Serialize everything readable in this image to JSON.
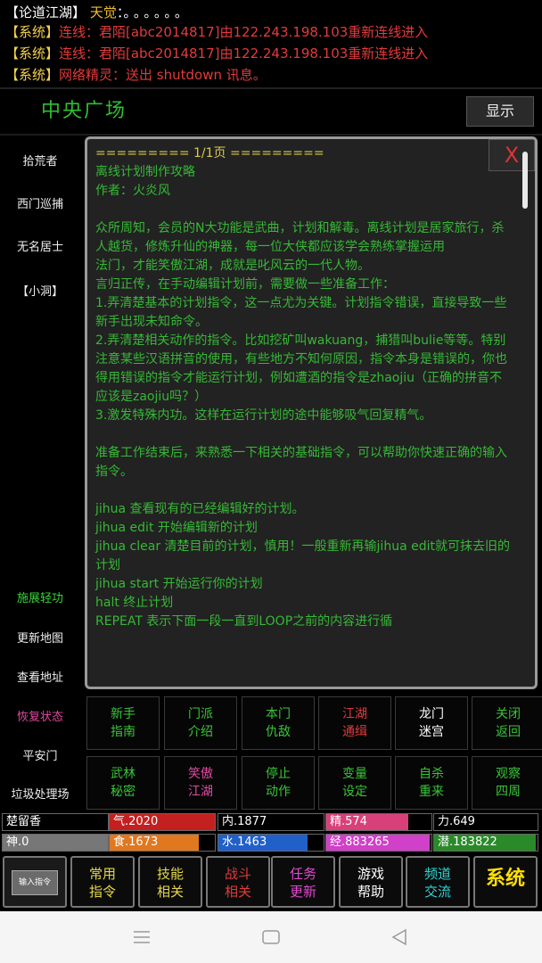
{
  "chat": {
    "title": {
      "bracket_open": "【",
      "channel": "论道江湖",
      "bracket_close": "】",
      "name": "天觉",
      "sep": "：",
      "dots": "。。。。。。"
    },
    "lines": [
      {
        "tag": "【系统】",
        "text": "连线：君陌[abc2014817]由122.243.198.103重新连线进入"
      },
      {
        "tag": "【系统】",
        "text": "连线：君陌[abc2014817]由122.243.198.103重新连线进入"
      },
      {
        "tag": "【系统】",
        "text": "网络精灵：送出 shutdown 讯息。"
      }
    ]
  },
  "header": {
    "room": "中央广场",
    "show_button": "显示"
  },
  "sidebar": {
    "top": [
      "拾荒者",
      "西门巡捕",
      "无名居士",
      "【小洞】"
    ],
    "bottom": [
      {
        "label": "施展轻功",
        "color": "green"
      },
      {
        "label": "更新地图",
        "color": "white"
      },
      {
        "label": "查看地址",
        "color": "white"
      },
      {
        "label": "恢复状态",
        "color": "pink"
      },
      {
        "label": "平安门",
        "color": "white"
      },
      {
        "label": "垃圾处理场",
        "color": "white"
      }
    ]
  },
  "dialog": {
    "page_header": "========= 1/1页 =========",
    "close": "X",
    "body": "离线计划制作攻略\n作者：火炎风\n\n众所周知，会员的N大功能是武曲，计划和解毒。离线计划是居家旅行，杀人越货，修炼升仙的神器，每一位大侠都应该学会熟练掌握运用\n法门，才能笑傲江湖，成就是叱风云的一代人物。\n言归正传，在手动编辑计划前，需要做一些准备工作：\n1.弄清楚基本的计划指令，这一点尤为关键。计划指令错误，直接导致一些新手出现未知命令。\n2.弄清楚相关动作的指令。比如挖矿叫wakuang，捕猎叫bulie等等。特别注意某些汉语拼音的使用，有些地方不知何原因，指令本身是错误的，你也得用错误的指令才能运行计划，例如遭酒的指令是zhaojiu（正确的拼音不应该是zaojiu吗？）\n3.激发特殊内功。这样在运行计划的途中能够吸气回复精气。\n\n准备工作结束后，来熟悉一下相关的基础指令，可以帮助你快速正确的输入指令。\n\njihua 查看现有的已经编辑好的计划。\njihua edit 开始编辑新的计划\njihua clear 清楚目前的计划，慎用！一般重新再输jihua edit就可抹去旧的计划\njihua start 开始运行你的计划\nhalt 终止计划\nREPEAT 表示下面一段一直到LOOP之前的内容进行循"
  },
  "actions": [
    {
      "l1": "新手",
      "l2": "指南",
      "color": "#39c439"
    },
    {
      "l1": "门派",
      "l2": "介绍",
      "color": "#39c439"
    },
    {
      "l1": "本门",
      "l2": "仇敌",
      "color": "#39c439"
    },
    {
      "l1": "江湖",
      "l2": "通缉",
      "color": "#e23b3b"
    },
    {
      "l1": "龙门",
      "l2": "迷宫",
      "color": "#ffffff"
    },
    {
      "l1": "关闭",
      "l2": "返回",
      "color": "#39c439"
    },
    {
      "l1": "武林",
      "l2": "秘密",
      "color": "#39c439"
    },
    {
      "l1": "笑傲",
      "l2": "江湖",
      "color": "#e04aa0"
    },
    {
      "l1": "停止",
      "l2": "动作",
      "color": "#39c439"
    },
    {
      "l1": "变量",
      "l2": "设定",
      "color": "#39c439"
    },
    {
      "l1": "自杀",
      "l2": "重来",
      "color": "#39c439"
    },
    {
      "l1": "观察",
      "l2": "四周",
      "color": "#39c439"
    }
  ],
  "stats": {
    "row1": [
      {
        "label": "楚留香",
        "fill": 0.0,
        "color": "#000000"
      },
      {
        "label": "气.2020",
        "fill": 1.0,
        "color": "#c42020"
      },
      {
        "label": "内.1877",
        "fill": 0.0,
        "color": "#000000"
      },
      {
        "label": "精.574",
        "fill": 0.78,
        "color": "#d8407a"
      },
      {
        "label": "力.649",
        "fill": 0.0,
        "color": "#000000"
      }
    ],
    "row2": [
      {
        "label": "神.0",
        "fill": 0.0,
        "color": "#000000"
      },
      {
        "label": "食.1673",
        "fill": 0.85,
        "color": "#e07820"
      },
      {
        "label": "水.1463",
        "fill": 0.85,
        "color": "#2060c8"
      },
      {
        "label": "经.883265",
        "fill": 0.98,
        "color": "#d040c8"
      },
      {
        "label": "潜.183822",
        "fill": 0.98,
        "color": "#2a8a2a"
      }
    ]
  },
  "toolbar": {
    "input_label": "输入指令",
    "buttons": [
      {
        "l1": "常用",
        "l2": "指令",
        "color": "#e6d84a"
      },
      {
        "l1": "技能",
        "l2": "相关",
        "color": "#e6d84a"
      },
      {
        "l1": "战斗",
        "l2": "相关",
        "color": "#e23b3b"
      },
      {
        "l1": "任务",
        "l2": "更新",
        "color": "#e04ad0"
      },
      {
        "l1": "游戏",
        "l2": "帮助",
        "color": "#ffffff"
      },
      {
        "l1": "频道",
        "l2": "交流",
        "color": "#2fd4d4"
      }
    ],
    "system": "系统"
  },
  "navbar": {
    "icons": [
      "menu-icon",
      "home-icon",
      "back-icon"
    ]
  }
}
